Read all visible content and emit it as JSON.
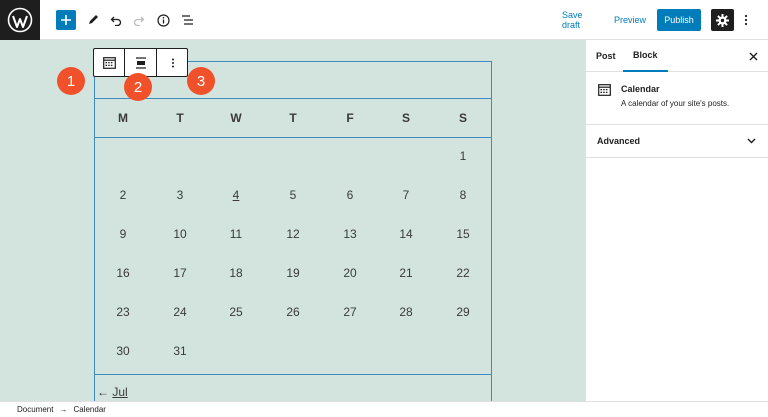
{
  "header": {
    "save_draft": "Save draft",
    "preview": "Preview",
    "publish": "Publish"
  },
  "toolbar_icons": [
    "wordpress-logo",
    "plus",
    "pencil",
    "undo",
    "redo",
    "info",
    "list-view",
    "gear",
    "more-vertical"
  ],
  "calendar": {
    "weekdays": [
      "M",
      "T",
      "W",
      "T",
      "F",
      "S",
      "S"
    ],
    "weeks": [
      [
        "",
        "",
        "",
        "",
        "",
        "",
        "1"
      ],
      [
        "2",
        "3",
        "4",
        "5",
        "6",
        "7",
        "8"
      ],
      [
        "9",
        "10",
        "11",
        "12",
        "13",
        "14",
        "15"
      ],
      [
        "16",
        "17",
        "18",
        "19",
        "20",
        "21",
        "22"
      ],
      [
        "23",
        "24",
        "25",
        "26",
        "27",
        "28",
        "29"
      ],
      [
        "30",
        "31",
        "",
        "",
        "",
        "",
        ""
      ]
    ],
    "today": "4",
    "prev_arrow": "←",
    "prev_month": "Jul"
  },
  "markers": [
    "1",
    "2",
    "3"
  ],
  "sidebar": {
    "tabs": [
      "Post",
      "Block"
    ],
    "active_tab": "Block",
    "block_title": "Calendar",
    "block_description": "A calendar of your site's posts.",
    "advanced": "Advanced"
  },
  "breadcrumb": {
    "root": "Document",
    "separator": "→",
    "current": "Calendar"
  },
  "colors": {
    "accent": "#007cba",
    "canvas_bg": "#d2e4dd",
    "marker": "#f1512a",
    "dark": "#1e1e1e"
  }
}
